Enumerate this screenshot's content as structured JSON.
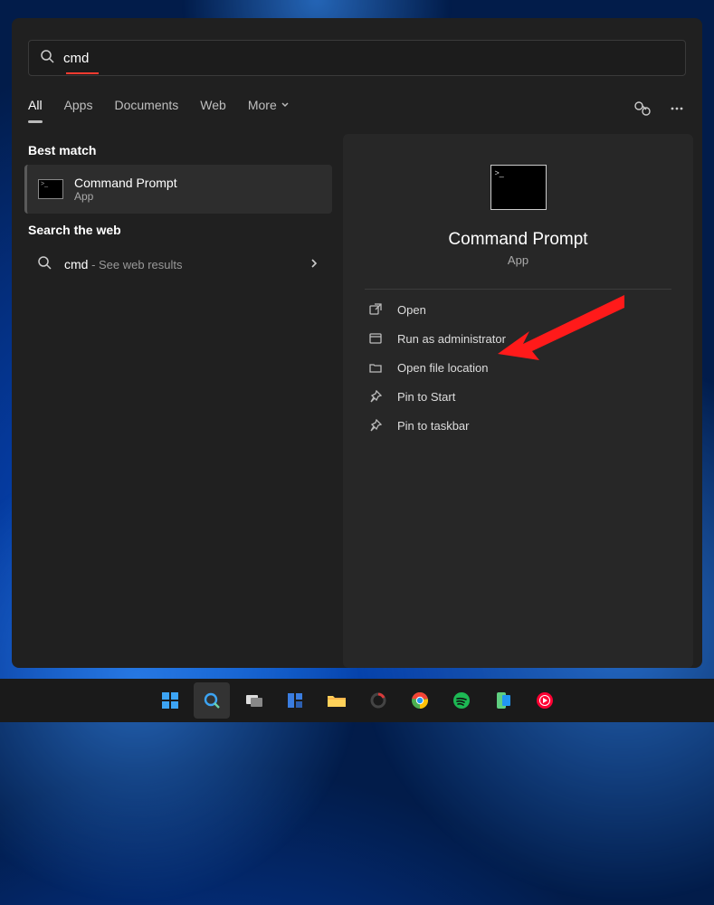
{
  "search": {
    "value": "cmd"
  },
  "tabs": [
    {
      "label": "All",
      "active": true
    },
    {
      "label": "Apps",
      "active": false
    },
    {
      "label": "Documents",
      "active": false
    },
    {
      "label": "Web",
      "active": false
    },
    {
      "label": "More",
      "active": false,
      "dropdown": true
    }
  ],
  "left": {
    "best_match_heading": "Best match",
    "best_item": {
      "title": "Command Prompt",
      "subtitle": "App"
    },
    "web_heading": "Search the web",
    "web_item": {
      "query": "cmd",
      "hint": " - See web results"
    }
  },
  "detail": {
    "title": "Command Prompt",
    "subtitle": "App",
    "actions": [
      {
        "icon": "open",
        "label": "Open"
      },
      {
        "icon": "shield",
        "label": "Run as administrator"
      },
      {
        "icon": "folder",
        "label": "Open file location"
      },
      {
        "icon": "pin",
        "label": "Pin to Start"
      },
      {
        "icon": "pin",
        "label": "Pin to taskbar"
      }
    ]
  },
  "taskbar": [
    {
      "name": "start",
      "active": false
    },
    {
      "name": "search",
      "active": true
    },
    {
      "name": "taskview",
      "active": false
    },
    {
      "name": "widgets",
      "active": false
    },
    {
      "name": "explorer",
      "active": false
    },
    {
      "name": "app-o",
      "active": false
    },
    {
      "name": "chrome",
      "active": false
    },
    {
      "name": "spotify",
      "active": false
    },
    {
      "name": "phone",
      "active": false
    },
    {
      "name": "youtube-music",
      "active": false
    }
  ]
}
